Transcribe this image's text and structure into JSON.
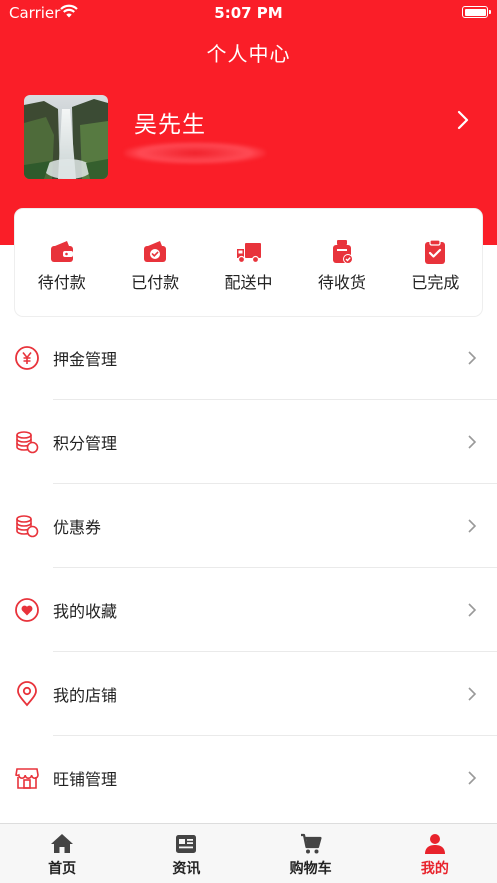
{
  "status_bar": {
    "carrier": "Carrier",
    "time": "5:07 PM"
  },
  "header": {
    "title": "个人中心"
  },
  "profile": {
    "name": "吴先生",
    "phone": ""
  },
  "orders": [
    {
      "label": "待付款",
      "icon": "wallet-icon"
    },
    {
      "label": "已付款",
      "icon": "paid-wallet-icon"
    },
    {
      "label": "配送中",
      "icon": "truck-icon"
    },
    {
      "label": "待收货",
      "icon": "package-icon"
    },
    {
      "label": "已完成",
      "icon": "clipboard-check-icon"
    }
  ],
  "menu": [
    {
      "label": "押金管理",
      "icon": "yen-circle-icon"
    },
    {
      "label": "积分管理",
      "icon": "coins-stack-icon"
    },
    {
      "label": "优惠券",
      "icon": "coins-stack-icon"
    },
    {
      "label": "我的收藏",
      "icon": "heart-circle-icon"
    },
    {
      "label": "我的店铺",
      "icon": "location-pin-icon"
    },
    {
      "label": "旺铺管理",
      "icon": "storefront-icon"
    }
  ],
  "tabs": [
    {
      "label": "首页",
      "icon": "home-icon",
      "active": false
    },
    {
      "label": "资讯",
      "icon": "news-icon",
      "active": false
    },
    {
      "label": "购物车",
      "icon": "cart-icon",
      "active": false
    },
    {
      "label": "我的",
      "icon": "user-icon",
      "active": true
    }
  ],
  "colors": {
    "brand": "#fa1e28",
    "active_tab": "#e8232c",
    "icon_red": "#e8333b"
  }
}
